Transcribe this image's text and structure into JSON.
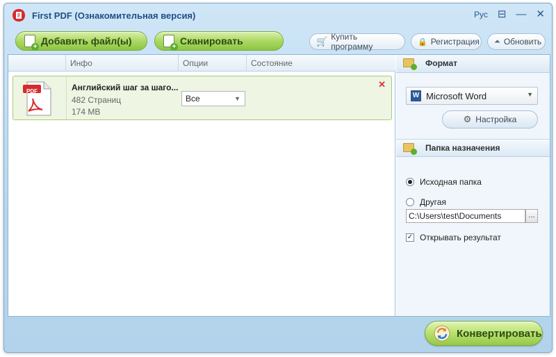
{
  "window": {
    "title": "First PDF (Ознакомительная версия)",
    "language": "Рус"
  },
  "toolbar": {
    "add_files": "Добавить файл(ы)",
    "scan": "Сканировать",
    "buy": "Купить программу",
    "register": "Регистрация",
    "update": "Обновить"
  },
  "list": {
    "columns": [
      "Инфо",
      "Опции",
      "Состояние"
    ],
    "files": [
      {
        "name": "Английский шаг за шаго...",
        "pages": "482 Страниц",
        "size": "174 MB",
        "option": "Все",
        "icon_label": "PDF"
      }
    ]
  },
  "format": {
    "header": "Формат",
    "selected": "Microsoft Word",
    "word_icon_letter": "W",
    "settings_label": "Настройка"
  },
  "destination": {
    "header": "Папка назначения",
    "option_source": "Исходная папка",
    "option_other": "Другая",
    "selected": "Исходная папка",
    "path": "C:\\Users\\test\\Documents",
    "browse_label": "...",
    "open_result_label": "Открывать результат",
    "open_result_checked": true
  },
  "convert": {
    "label": "Конвертировать"
  },
  "colors": {
    "accent_green": "#8cc642",
    "title_blue": "#1f4f86",
    "remove_red": "#dd3333"
  }
}
